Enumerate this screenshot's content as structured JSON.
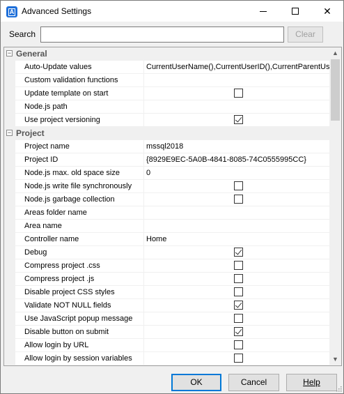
{
  "window": {
    "title": "Advanced Settings"
  },
  "search": {
    "label": "Search",
    "value": "",
    "placeholder": "",
    "clear_label": "Clear"
  },
  "categories": [
    {
      "label": "General",
      "properties": [
        {
          "name": "Auto-Update values",
          "value": "CurrentUserName(),CurrentUserID(),CurrentParentUse"
        },
        {
          "name": "Custom validation functions",
          "value": ""
        },
        {
          "name": "Update template on start",
          "checkbox": true,
          "checked": false
        },
        {
          "name": "Node.js path",
          "value": ""
        },
        {
          "name": "Use project versioning",
          "checkbox": true,
          "checked": true
        }
      ]
    },
    {
      "label": "Project",
      "properties": [
        {
          "name": "Project name",
          "value": "mssql2018"
        },
        {
          "name": "Project ID",
          "value": "{8929E9EC-5A0B-4841-8085-74C0555995CC}"
        },
        {
          "name": "Node.js max. old space size",
          "value": "0"
        },
        {
          "name": "Node.js write file synchronously",
          "checkbox": true,
          "checked": false
        },
        {
          "name": "Node.js garbage collection",
          "checkbox": true,
          "checked": false
        },
        {
          "name": "Areas folder name",
          "value": ""
        },
        {
          "name": "Area name",
          "value": ""
        },
        {
          "name": "Controller name",
          "value": "Home"
        },
        {
          "name": "Debug",
          "checkbox": true,
          "checked": true
        },
        {
          "name": "Compress project .css",
          "checkbox": true,
          "checked": false
        },
        {
          "name": "Compress project .js",
          "checkbox": true,
          "checked": false
        },
        {
          "name": "Disable project CSS styles",
          "checkbox": true,
          "checked": false
        },
        {
          "name": "Validate NOT NULL fields",
          "checkbox": true,
          "checked": true
        },
        {
          "name": "Use JavaScript popup message",
          "checkbox": true,
          "checked": false
        },
        {
          "name": "Disable button on submit",
          "checkbox": true,
          "checked": true
        },
        {
          "name": "Allow login by URL",
          "checkbox": true,
          "checked": false
        },
        {
          "name": "Allow login by session variables",
          "checkbox": true,
          "checked": false
        }
      ]
    }
  ],
  "buttons": {
    "ok": "OK",
    "cancel": "Cancel",
    "help": "Help"
  },
  "icons": {
    "app": "app-logo-icon",
    "minimize": "minimize-icon",
    "maximize": "maximize-icon",
    "close": "close-icon",
    "collapse": "collapse-icon",
    "scroll_up": "scroll-up-icon",
    "scroll_down": "scroll-down-icon"
  }
}
